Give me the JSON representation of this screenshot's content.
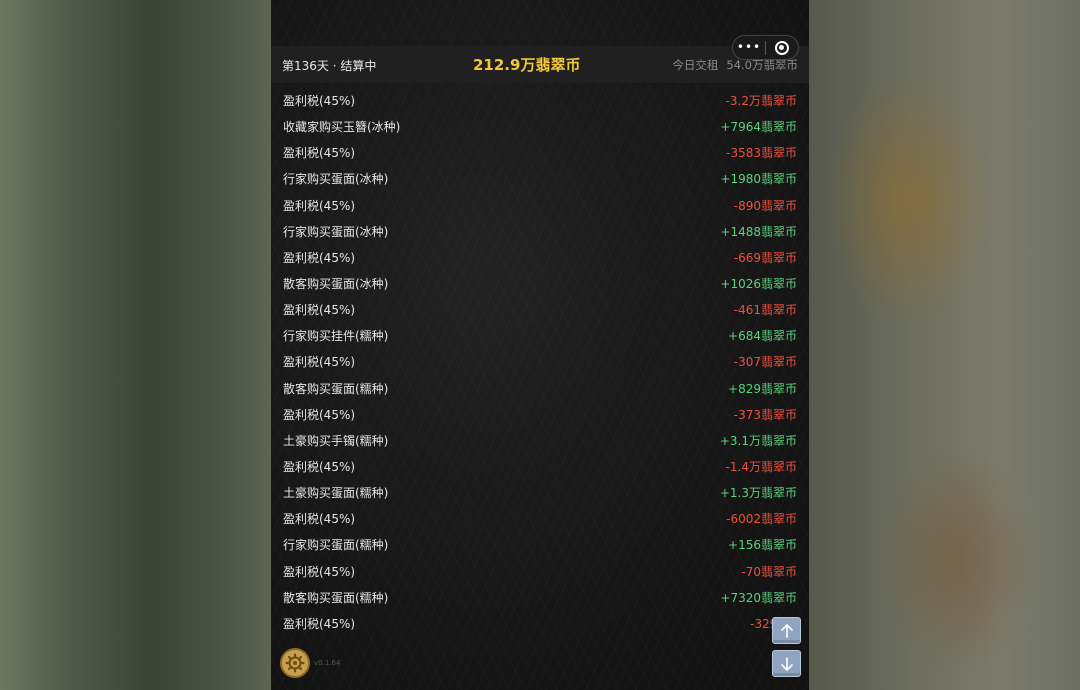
{
  "header": {
    "day_status": "第136天 · 结算中",
    "balance": "212.9万翡翠币",
    "rent_label": "今日交租",
    "rent_value": "54.0万翡翠币"
  },
  "capsule": {
    "more_icon": "more-icon",
    "close_icon": "target-icon"
  },
  "log": [
    {
      "desc": "盈利税(45%)",
      "amount": "-3.2万翡翠币",
      "type": "neg"
    },
    {
      "desc": "收藏家购买玉簪(冰种)",
      "amount": "+7964翡翠币",
      "type": "pos"
    },
    {
      "desc": "盈利税(45%)",
      "amount": "-3583翡翠币",
      "type": "neg"
    },
    {
      "desc": "行家购买蛋面(冰种)",
      "amount": "+1980翡翠币",
      "type": "pos"
    },
    {
      "desc": "盈利税(45%)",
      "amount": "-890翡翠币",
      "type": "neg"
    },
    {
      "desc": "行家购买蛋面(冰种)",
      "amount": "+1488翡翠币",
      "type": "pos"
    },
    {
      "desc": "盈利税(45%)",
      "amount": "-669翡翠币",
      "type": "neg"
    },
    {
      "desc": "散客购买蛋面(冰种)",
      "amount": "+1026翡翠币",
      "type": "pos"
    },
    {
      "desc": "盈利税(45%)",
      "amount": "-461翡翠币",
      "type": "neg"
    },
    {
      "desc": "行家购买挂件(糯种)",
      "amount": "+684翡翠币",
      "type": "pos"
    },
    {
      "desc": "盈利税(45%)",
      "amount": "-307翡翠币",
      "type": "neg"
    },
    {
      "desc": "散客购买蛋面(糯种)",
      "amount": "+829翡翠币",
      "type": "pos"
    },
    {
      "desc": "盈利税(45%)",
      "amount": "-373翡翠币",
      "type": "neg"
    },
    {
      "desc": "土豪购买手镯(糯种)",
      "amount": "+3.1万翡翠币",
      "type": "pos"
    },
    {
      "desc": "盈利税(45%)",
      "amount": "-1.4万翡翠币",
      "type": "neg"
    },
    {
      "desc": "土豪购买蛋面(糯种)",
      "amount": "+1.3万翡翠币",
      "type": "pos"
    },
    {
      "desc": "盈利税(45%)",
      "amount": "-6002翡翠币",
      "type": "neg"
    },
    {
      "desc": "行家购买蛋面(糯种)",
      "amount": "+156翡翠币",
      "type": "pos"
    },
    {
      "desc": "盈利税(45%)",
      "amount": "-70翡翠币",
      "type": "neg"
    },
    {
      "desc": "散客购买蛋面(糯种)",
      "amount": "+7320翡翠币",
      "type": "pos"
    },
    {
      "desc": "盈利税(45%)",
      "amount": "-3293翡",
      "type": "neg"
    }
  ],
  "footer": {
    "version": "v0.1.64"
  },
  "colors": {
    "negative": "#f0503e",
    "positive": "#5bd27b",
    "balance": "#f2c53b"
  }
}
